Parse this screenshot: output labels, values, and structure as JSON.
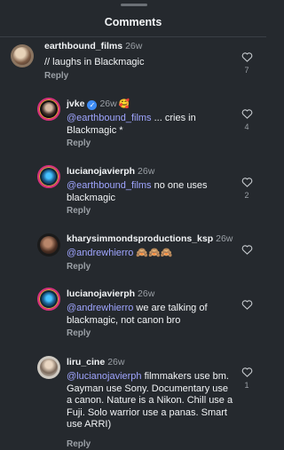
{
  "header": {
    "title": "Comments"
  },
  "comments": [
    {
      "username": "earthbound_films",
      "time": "26w",
      "mention": "",
      "text": "// laughs in Blackmagic",
      "reply_label": "Reply",
      "likes": "7"
    },
    {
      "username": "jvke",
      "time": "26w",
      "badge_icon": "verified-icon",
      "emoji_badge": "🥰",
      "mention": "@earthbound_films",
      "text": " ... cries in Blackmagic *",
      "reply_label": "Reply",
      "likes": "4"
    },
    {
      "username": "lucianojavierph",
      "time": "26w",
      "mention": "@earthbound_films",
      "text": " no one uses blackmagic",
      "reply_label": "Reply",
      "likes": "2"
    },
    {
      "username": "kharysimmondsproductions_ksp",
      "time": "26w",
      "mention": "@andrewhierro",
      "text": " 🙈🙈🙈",
      "reply_label": "Reply",
      "likes": ""
    },
    {
      "username": "lucianojavierph",
      "time": "26w",
      "mention": "@andrewhierro",
      "text": " we are talking of blackmagic, not canon bro",
      "reply_label": "Reply",
      "likes": ""
    },
    {
      "username": "liru_cine",
      "time": "26w",
      "mention": "@lucianojavierph",
      "text": " filmmakers use bm. Gayman use Sony. Documentary use a canon. Nature is a Nikon. Chill use a Fuji. Solo warrior use a panas. Smart use ARRI)",
      "reply_label": "Reply",
      "likes": "1"
    }
  ]
}
